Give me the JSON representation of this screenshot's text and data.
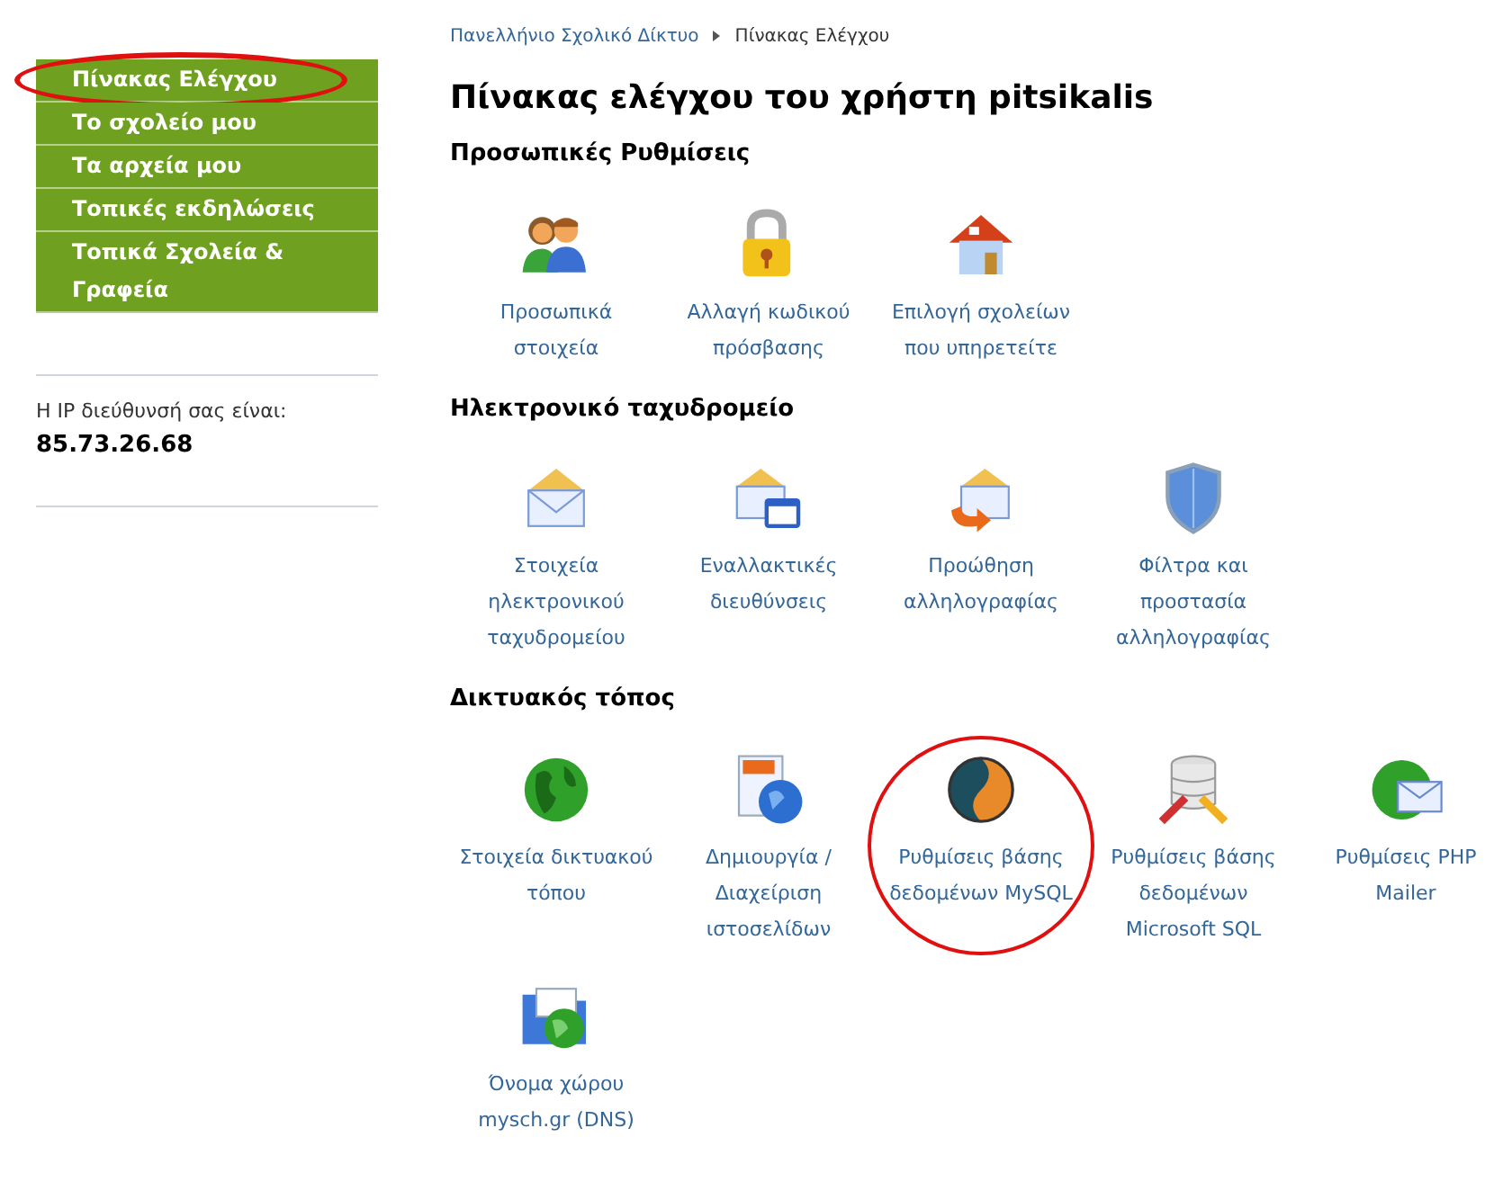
{
  "sidebar": {
    "items": [
      {
        "label": "Πίνακας Ελέγχου",
        "highlighted": true
      },
      {
        "label": "Το σχολείο μου",
        "highlighted": false
      },
      {
        "label": "Τα αρχεία μου",
        "highlighted": false
      },
      {
        "label": "Τοπικές εκδηλώσεις",
        "highlighted": false
      },
      {
        "label": "Τοπικά Σχολεία & Γραφεία",
        "highlighted": false
      }
    ],
    "ip_label": "Η IP διεύθυνσή σας είναι:",
    "ip_value": "85.73.26.68"
  },
  "breadcrumb": [
    "Πανελλήνιο Σχολικό Δίκτυο",
    "Πίνακας Ελέγχου"
  ],
  "title": "Πίνακας ελέγχου του χρήστη pitsikalis",
  "sections": [
    {
      "heading": "Προσωπικές Ρυθμίσεις",
      "items": [
        {
          "kind": "people",
          "label": "Προσωπικά στοιχεία",
          "highlighted": false
        },
        {
          "kind": "lock",
          "label": "Αλλαγή κωδικού πρόσβασης",
          "highlighted": false
        },
        {
          "kind": "house",
          "label": "Επιλογή σχολείων που υπηρετείτε",
          "highlighted": false
        }
      ]
    },
    {
      "heading": "Ηλεκτρονικό ταχυδρομείο",
      "items": [
        {
          "kind": "envelope",
          "label": "Στοιχεία ηλεκτρονικού ταχυδρομείου",
          "highlighted": false
        },
        {
          "kind": "envelope-window",
          "label": "Εναλλακτικές διευθύνσεις",
          "highlighted": false
        },
        {
          "kind": "envelope-arrow",
          "label": "Προώθηση αλληλογραφίας",
          "highlighted": false
        },
        {
          "kind": "shield",
          "label": "Φίλτρα και προστασία αλληλογραφίας",
          "highlighted": false
        }
      ]
    },
    {
      "heading": "Δικτυακός τόπος",
      "items": [
        {
          "kind": "globe",
          "label": "Στοιχεία δικτυακού τόπου",
          "highlighted": false
        },
        {
          "kind": "page-globe",
          "label": "Δημιουργία / Διαχείριση ιστοσελίδων",
          "highlighted": false
        },
        {
          "kind": "disc",
          "label": "Ρυθμίσεις βάσης δεδομένων MySQL",
          "highlighted": true
        },
        {
          "kind": "database",
          "label": "Ρυθμίσεις βάσης δεδομένων Microsoft SQL",
          "highlighted": false
        },
        {
          "kind": "globe-mail",
          "label": "Ρυθμίσεις PHP Mailer",
          "highlighted": false
        },
        {
          "kind": "folder-globe",
          "label": "Όνομα χώρου mysch.gr (DNS)",
          "highlighted": false
        }
      ]
    }
  ]
}
